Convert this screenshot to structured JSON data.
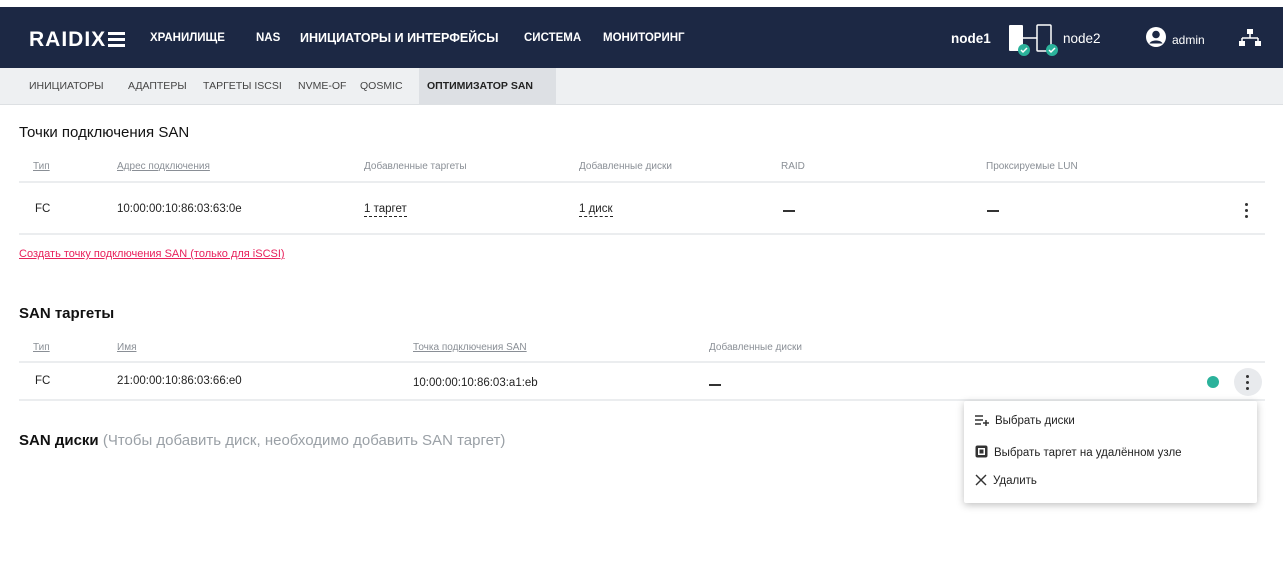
{
  "app": {
    "logo": "RAIDIX"
  },
  "nav": {
    "items": [
      "ХРАНИЛИЩЕ",
      "NAS",
      "ИНИЦИАТОРЫ И ИНТЕРФЕЙСЫ",
      "СИСТЕМА",
      "МОНИТОРИНГ"
    ],
    "active_index": 2,
    "node1": "node1",
    "node2": "node2",
    "user": "admin"
  },
  "subnav": {
    "items": [
      "ИНИЦИАТОРЫ",
      "АДАПТЕРЫ",
      "ТАРГЕТЫ ISCSI",
      "NVME-OF",
      "QOSMIC",
      "ОПТИМИЗАТОР SAN"
    ],
    "active_index": 5
  },
  "san_points": {
    "title": "Точки подключения SAN",
    "headers": [
      "Тип",
      "Адрес подключения",
      "Добавленные таргеты",
      "Добавленные диски",
      "RAID",
      "Проксируемые LUN"
    ],
    "rows": [
      {
        "type": "FC",
        "address": "10:00:00:10:86:03:63:0e",
        "targets": "1 таргет",
        "disks": "1 диск",
        "raid": "—",
        "lun": "—"
      }
    ],
    "create_link": "Создать точку подключения SAN (только для iSCSI)"
  },
  "san_targets": {
    "title": "SAN таргеты",
    "headers": [
      "Тип",
      "Имя",
      "Точка подключения SAN",
      "Добавленные диски"
    ],
    "rows": [
      {
        "type": "FC",
        "name": "21:00:00:10:86:03:66:e0",
        "point": "10:00:00:10:86:03:a1:eb",
        "disks": "—"
      }
    ],
    "status_color": "#2bb29b"
  },
  "san_disks": {
    "title": "SAN диски",
    "hint": "(Чтобы добавить диск, необходимо добавить SAN таргет)"
  },
  "context_menu": {
    "items": [
      {
        "label": "Выбрать диски",
        "icon": "add-list-icon"
      },
      {
        "label": "Выбрать таргет на удалённом узле",
        "icon": "target-box-icon"
      },
      {
        "label": "Удалить",
        "icon": "close-icon"
      }
    ]
  },
  "colors": {
    "topbar": "#1c2844",
    "accent": "#e8205b",
    "status_ok": "#2bb29b"
  }
}
